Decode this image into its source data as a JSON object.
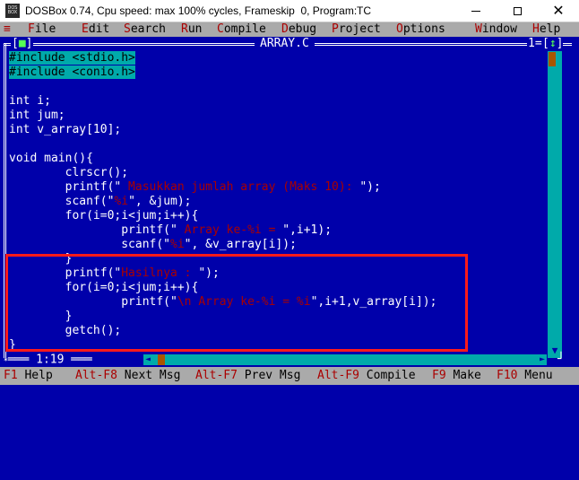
{
  "window": {
    "icon_text": "DOS BOX",
    "title": "DOSBox 0.74, Cpu speed: max 100% cycles, Frameskip  0, Program:",
    "program": "TC",
    "close_glyph": "✕"
  },
  "menu": {
    "system": "≡",
    "items": [
      {
        "hotkey": "F",
        "rest": "ile"
      },
      {
        "hotkey": "E",
        "rest": "dit"
      },
      {
        "hotkey": "S",
        "rest": "earch"
      },
      {
        "hotkey": "R",
        "rest": "un"
      },
      {
        "hotkey": "C",
        "rest": "ompile"
      },
      {
        "hotkey": "D",
        "rest": "ebug"
      },
      {
        "hotkey": "P",
        "rest": "roject"
      },
      {
        "hotkey": "O",
        "rest": "ptions"
      },
      {
        "hotkey": "W",
        "rest": "indow"
      },
      {
        "hotkey": "H",
        "rest": "elp"
      }
    ]
  },
  "editor": {
    "close_box_open": "[",
    "close_box_glyph": "■",
    "close_box_close": "]",
    "file_name": "ARRAY.C",
    "window_number": "1=",
    "zoom_open": "[",
    "zoom_glyph": "↕",
    "zoom_close": "]",
    "position": "1:19",
    "scroll_up": "▲",
    "scroll_down": "▼",
    "scroll_left": "◄",
    "scroll_right": "►",
    "lines": [
      [
        {
          "t": "#include <stdio.h>",
          "c": "hl"
        }
      ],
      [
        {
          "t": "#include <conio.h>",
          "c": "hl"
        }
      ],
      [
        {
          "t": "",
          "c": ""
        }
      ],
      [
        {
          "t": "int i;",
          "c": ""
        }
      ],
      [
        {
          "t": "int jum;",
          "c": ""
        }
      ],
      [
        {
          "t": "int v_array[10];",
          "c": ""
        }
      ],
      [
        {
          "t": "",
          "c": ""
        }
      ],
      [
        {
          "t": "void main(){",
          "c": ""
        }
      ],
      [
        {
          "t": "        clrscr();",
          "c": ""
        }
      ],
      [
        {
          "t": "        printf(\"",
          "c": ""
        },
        {
          "t": " Masukkan jumlah array (Maks 10): ",
          "c": "fade"
        },
        {
          "t": "\");",
          "c": ""
        }
      ],
      [
        {
          "t": "        scanf(\"",
          "c": ""
        },
        {
          "t": "%i",
          "c": "fade"
        },
        {
          "t": "\", &jum);",
          "c": ""
        }
      ],
      [
        {
          "t": "        for(i=0;i<jum;i++){",
          "c": ""
        }
      ],
      [
        {
          "t": "                printf(\"",
          "c": ""
        },
        {
          "t": " Array ke-%i = ",
          "c": "fade"
        },
        {
          "t": "\",i+1);",
          "c": ""
        }
      ],
      [
        {
          "t": "                scanf(\"",
          "c": ""
        },
        {
          "t": "%i",
          "c": "fade"
        },
        {
          "t": "\", &v_array[i]);",
          "c": ""
        }
      ],
      [
        {
          "t": "        }",
          "c": ""
        }
      ],
      [
        {
          "t": "        printf(\"",
          "c": ""
        },
        {
          "t": "Hasilnya : ",
          "c": "fade"
        },
        {
          "t": "\");",
          "c": ""
        }
      ],
      [
        {
          "t": "        for(i=0;i<jum;i++){",
          "c": ""
        }
      ],
      [
        {
          "t": "                printf(\"",
          "c": ""
        },
        {
          "t": "\\n Array ke-%i = %i",
          "c": "fade"
        },
        {
          "t": "\",i+1,v_array[i]);",
          "c": ""
        }
      ],
      [
        {
          "t": "        }",
          "c": ""
        }
      ],
      [
        {
          "t": "        getch();",
          "c": ""
        }
      ],
      [
        {
          "t": "}",
          "c": ""
        }
      ]
    ]
  },
  "statusbar": {
    "items": [
      {
        "key": "F1",
        "label": " Help"
      },
      {
        "key": "Alt-F8",
        "label": " Next Msg"
      },
      {
        "key": "Alt-F7",
        "label": " Prev Msg"
      },
      {
        "key": "Alt-F9",
        "label": " Compile"
      },
      {
        "key": "F9",
        "label": " Make"
      },
      {
        "key": "F10",
        "label": " Menu"
      }
    ]
  },
  "colors": {
    "editor_bg": "#0000AA",
    "menu_bg": "#AAAAAA",
    "hotkey": "#AA0000",
    "annotation": "#FF1A1A",
    "scrollbar": "#00AAAA",
    "thumb": "#AA5500"
  }
}
